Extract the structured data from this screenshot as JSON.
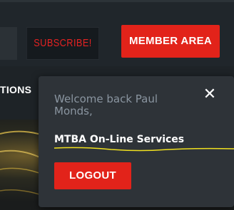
{
  "header": {
    "subscribe_label": "SUBSCRIBE!",
    "member_area_label": "MEMBER AREA"
  },
  "nav": {
    "partial_item": "TIONS"
  },
  "popup": {
    "welcome_text": "Welcome back Paul Monds,",
    "services_link": "MTBA On-Line Services",
    "logout_label": "LOGOUT",
    "close_icon": "close-icon"
  },
  "colors": {
    "brand_red": "#e2231a",
    "popup_bg": "#2e3338",
    "header_bg": "#20262b",
    "annotation_underline": "#f0e020"
  }
}
